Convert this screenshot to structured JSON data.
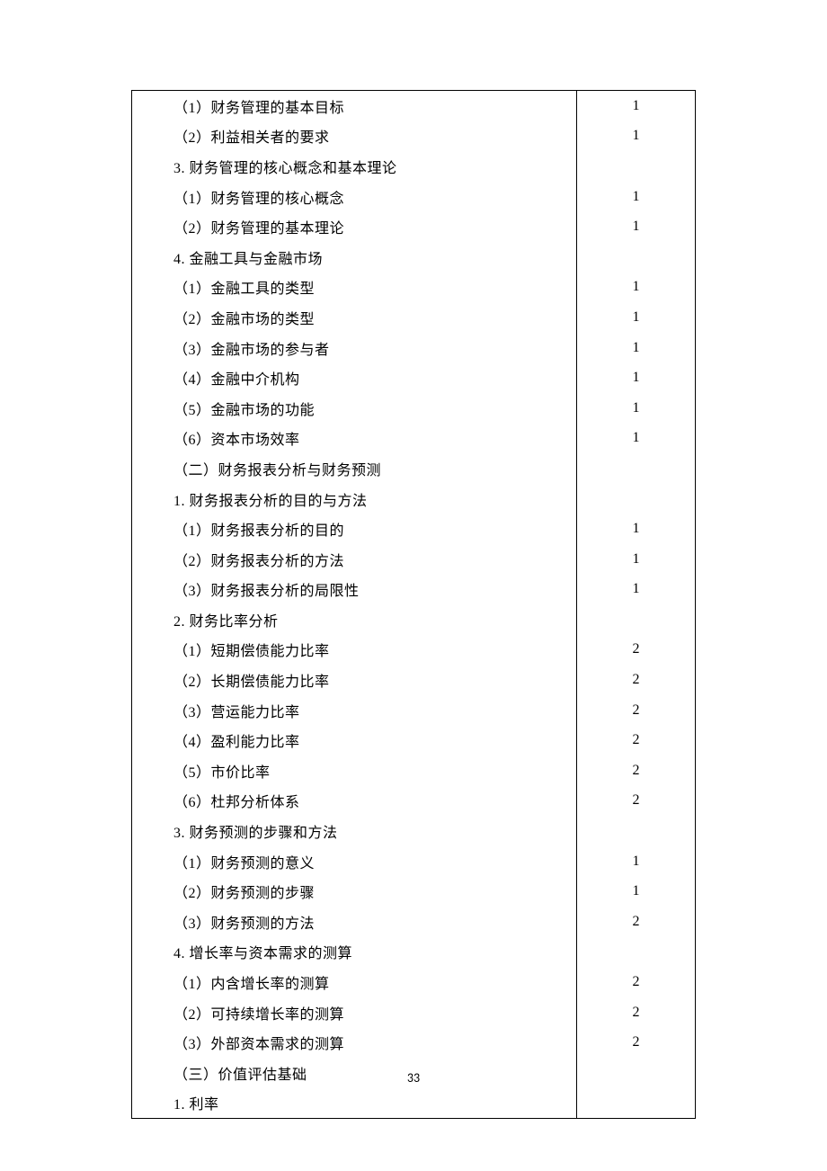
{
  "page_number": "33",
  "rows": [
    {
      "text": "（1）财务管理的基本目标",
      "value": "1"
    },
    {
      "text": "（2）利益相关者的要求",
      "value": "1"
    },
    {
      "text": "3. 财务管理的核心概念和基本理论",
      "value": ""
    },
    {
      "text": "（1）财务管理的核心概念",
      "value": "1"
    },
    {
      "text": "（2）财务管理的基本理论",
      "value": "1"
    },
    {
      "text": "4. 金融工具与金融市场",
      "value": ""
    },
    {
      "text": "（1）金融工具的类型",
      "value": "1"
    },
    {
      "text": "（2）金融市场的类型",
      "value": "1"
    },
    {
      "text": "（3）金融市场的参与者",
      "value": "1"
    },
    {
      "text": "（4）金融中介机构",
      "value": "1"
    },
    {
      "text": "（5）金融市场的功能",
      "value": "1"
    },
    {
      "text": "（6）资本市场效率",
      "value": "1"
    },
    {
      "text": "（二）财务报表分析与财务预测",
      "value": ""
    },
    {
      "text": "1. 财务报表分析的目的与方法",
      "value": ""
    },
    {
      "text": "（1）财务报表分析的目的",
      "value": "1"
    },
    {
      "text": "（2）财务报表分析的方法",
      "value": "1"
    },
    {
      "text": "（3）财务报表分析的局限性",
      "value": "1"
    },
    {
      "text": "2. 财务比率分析",
      "value": ""
    },
    {
      "text": "（1）短期偿债能力比率",
      "value": "2"
    },
    {
      "text": "（2）长期偿债能力比率",
      "value": "2"
    },
    {
      "text": "（3）营运能力比率",
      "value": "2"
    },
    {
      "text": "（4）盈利能力比率",
      "value": "2"
    },
    {
      "text": "（5）市价比率",
      "value": "2"
    },
    {
      "text": "（6）杜邦分析体系",
      "value": "2"
    },
    {
      "text": "3. 财务预测的步骤和方法",
      "value": ""
    },
    {
      "text": "（1）财务预测的意义",
      "value": "1"
    },
    {
      "text": "（2）财务预测的步骤",
      "value": "1"
    },
    {
      "text": "（3）财务预测的方法",
      "value": "2"
    },
    {
      "text": "4. 增长率与资本需求的测算",
      "value": ""
    },
    {
      "text": "（1）内含增长率的测算",
      "value": "2"
    },
    {
      "text": "（2）可持续增长率的测算",
      "value": "2"
    },
    {
      "text": "（3）外部资本需求的测算",
      "value": "2"
    },
    {
      "text": "（三）价值评估基础",
      "value": ""
    },
    {
      "text": "1. 利率",
      "value": ""
    }
  ]
}
